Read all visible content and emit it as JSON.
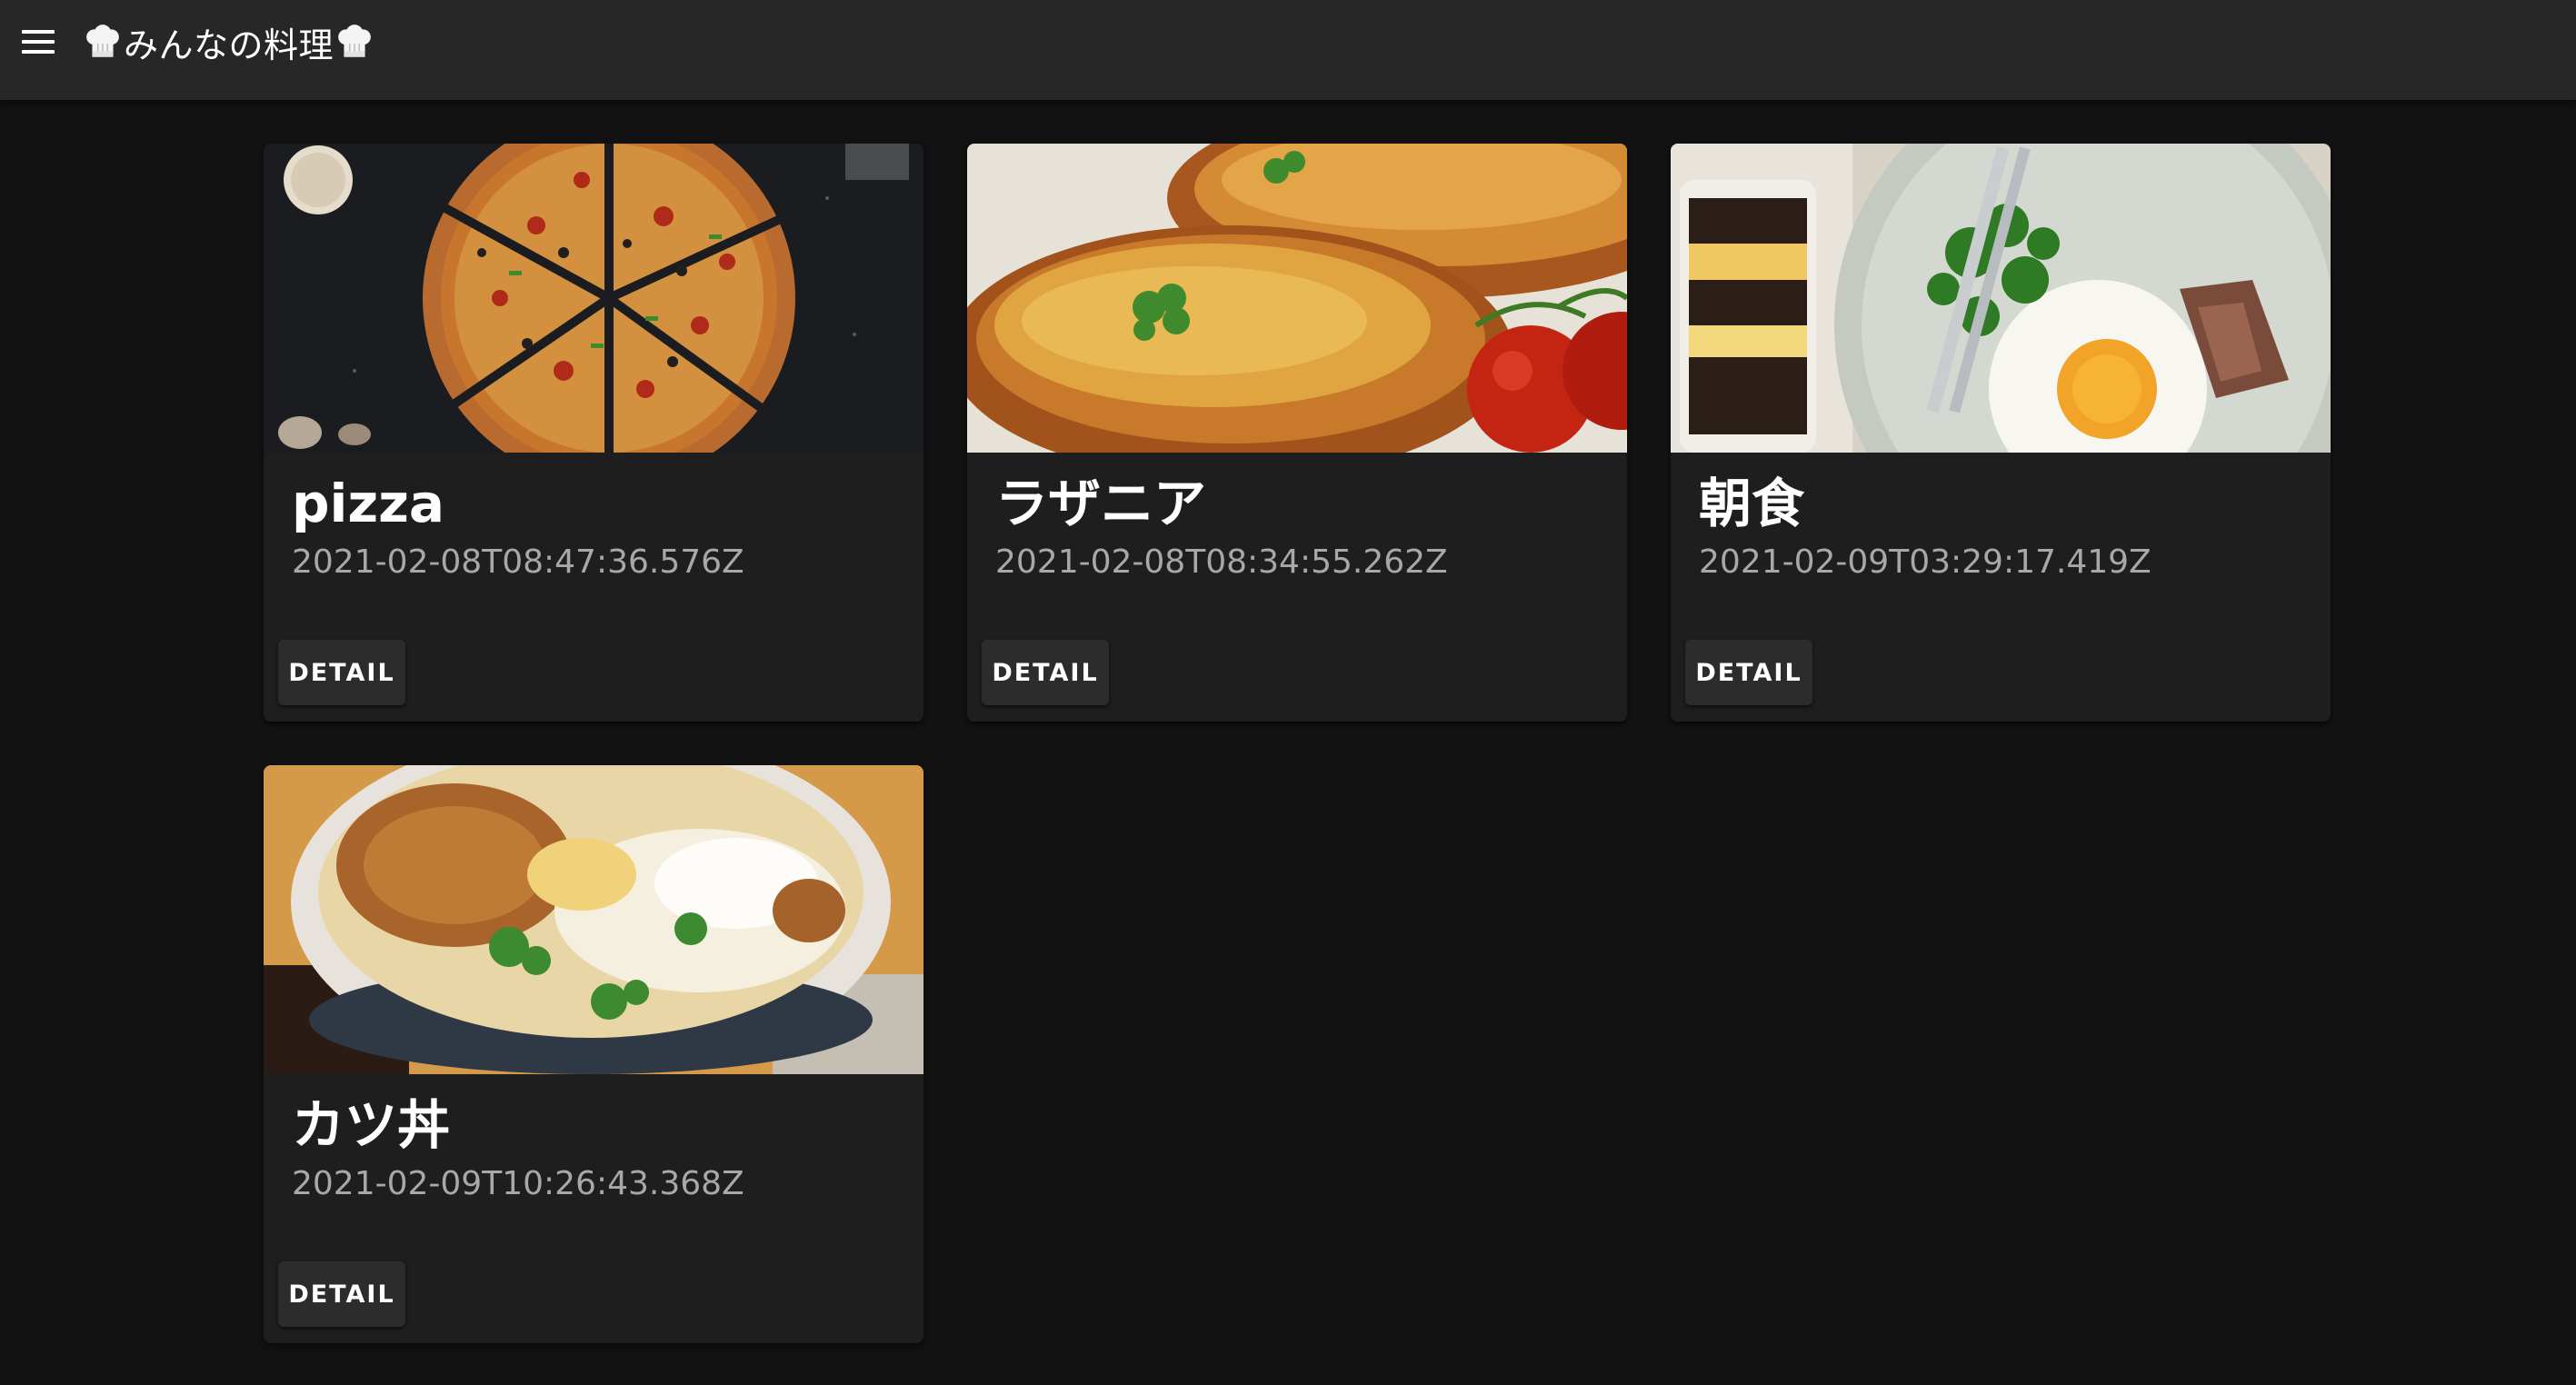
{
  "appbar": {
    "menu_icon": "menu-icon",
    "title": "みんなの料理",
    "title_icon": "chef-hat-icon"
  },
  "recipes": [
    {
      "title": "pizza",
      "created_at": "2021-02-08T08:47:36.576Z",
      "detail_label": "DETAIL",
      "image": "pizza-photo"
    },
    {
      "title": "ラザニア",
      "created_at": "2021-02-08T08:34:55.262Z",
      "detail_label": "DETAIL",
      "image": "lasagna-photo"
    },
    {
      "title": "朝食",
      "created_at": "2021-02-09T03:29:17.419Z",
      "detail_label": "DETAIL",
      "image": "breakfast-photo"
    },
    {
      "title": "カツ丼",
      "created_at": "2021-02-09T10:26:43.368Z",
      "detail_label": "DETAIL",
      "image": "katsudon-photo"
    }
  ],
  "colors": {
    "background": "#121212",
    "appbar": "#272727",
    "card": "#1e1e1e",
    "secondary_text": "#a8a8a8"
  }
}
